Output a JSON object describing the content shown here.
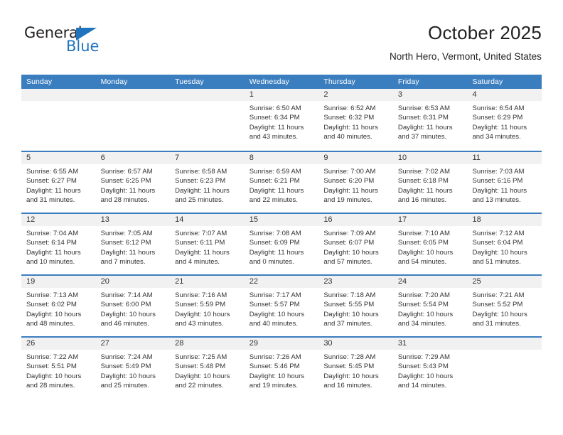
{
  "brand": {
    "name_primary": "General",
    "name_secondary": "Blue"
  },
  "header": {
    "title": "October 2025",
    "subtitle": "North Hero, Vermont, United States"
  },
  "colors": {
    "header_blue": "#3b7ebf",
    "brand_blue": "#1f74bd",
    "day_band_gray": "#f1f1f1",
    "text": "#333333"
  },
  "weekdays": [
    "Sunday",
    "Monday",
    "Tuesday",
    "Wednesday",
    "Thursday",
    "Friday",
    "Saturday"
  ],
  "labels": {
    "sunrise_prefix": "Sunrise: ",
    "sunset_prefix": "Sunset: ",
    "daylight_prefix": "Daylight: "
  },
  "weeks": [
    [
      {
        "empty": true
      },
      {
        "empty": true
      },
      {
        "empty": true
      },
      {
        "day": "1",
        "sunrise": "Sunrise: 6:50 AM",
        "sunset": "Sunset: 6:34 PM",
        "daylight": "Daylight: 11 hours and 43 minutes."
      },
      {
        "day": "2",
        "sunrise": "Sunrise: 6:52 AM",
        "sunset": "Sunset: 6:32 PM",
        "daylight": "Daylight: 11 hours and 40 minutes."
      },
      {
        "day": "3",
        "sunrise": "Sunrise: 6:53 AM",
        "sunset": "Sunset: 6:31 PM",
        "daylight": "Daylight: 11 hours and 37 minutes."
      },
      {
        "day": "4",
        "sunrise": "Sunrise: 6:54 AM",
        "sunset": "Sunset: 6:29 PM",
        "daylight": "Daylight: 11 hours and 34 minutes."
      }
    ],
    [
      {
        "day": "5",
        "sunrise": "Sunrise: 6:55 AM",
        "sunset": "Sunset: 6:27 PM",
        "daylight": "Daylight: 11 hours and 31 minutes."
      },
      {
        "day": "6",
        "sunrise": "Sunrise: 6:57 AM",
        "sunset": "Sunset: 6:25 PM",
        "daylight": "Daylight: 11 hours and 28 minutes."
      },
      {
        "day": "7",
        "sunrise": "Sunrise: 6:58 AM",
        "sunset": "Sunset: 6:23 PM",
        "daylight": "Daylight: 11 hours and 25 minutes."
      },
      {
        "day": "8",
        "sunrise": "Sunrise: 6:59 AM",
        "sunset": "Sunset: 6:21 PM",
        "daylight": "Daylight: 11 hours and 22 minutes."
      },
      {
        "day": "9",
        "sunrise": "Sunrise: 7:00 AM",
        "sunset": "Sunset: 6:20 PM",
        "daylight": "Daylight: 11 hours and 19 minutes."
      },
      {
        "day": "10",
        "sunrise": "Sunrise: 7:02 AM",
        "sunset": "Sunset: 6:18 PM",
        "daylight": "Daylight: 11 hours and 16 minutes."
      },
      {
        "day": "11",
        "sunrise": "Sunrise: 7:03 AM",
        "sunset": "Sunset: 6:16 PM",
        "daylight": "Daylight: 11 hours and 13 minutes."
      }
    ],
    [
      {
        "day": "12",
        "sunrise": "Sunrise: 7:04 AM",
        "sunset": "Sunset: 6:14 PM",
        "daylight": "Daylight: 11 hours and 10 minutes."
      },
      {
        "day": "13",
        "sunrise": "Sunrise: 7:05 AM",
        "sunset": "Sunset: 6:12 PM",
        "daylight": "Daylight: 11 hours and 7 minutes."
      },
      {
        "day": "14",
        "sunrise": "Sunrise: 7:07 AM",
        "sunset": "Sunset: 6:11 PM",
        "daylight": "Daylight: 11 hours and 4 minutes."
      },
      {
        "day": "15",
        "sunrise": "Sunrise: 7:08 AM",
        "sunset": "Sunset: 6:09 PM",
        "daylight": "Daylight: 11 hours and 0 minutes."
      },
      {
        "day": "16",
        "sunrise": "Sunrise: 7:09 AM",
        "sunset": "Sunset: 6:07 PM",
        "daylight": "Daylight: 10 hours and 57 minutes."
      },
      {
        "day": "17",
        "sunrise": "Sunrise: 7:10 AM",
        "sunset": "Sunset: 6:05 PM",
        "daylight": "Daylight: 10 hours and 54 minutes."
      },
      {
        "day": "18",
        "sunrise": "Sunrise: 7:12 AM",
        "sunset": "Sunset: 6:04 PM",
        "daylight": "Daylight: 10 hours and 51 minutes."
      }
    ],
    [
      {
        "day": "19",
        "sunrise": "Sunrise: 7:13 AM",
        "sunset": "Sunset: 6:02 PM",
        "daylight": "Daylight: 10 hours and 48 minutes."
      },
      {
        "day": "20",
        "sunrise": "Sunrise: 7:14 AM",
        "sunset": "Sunset: 6:00 PM",
        "daylight": "Daylight: 10 hours and 46 minutes."
      },
      {
        "day": "21",
        "sunrise": "Sunrise: 7:16 AM",
        "sunset": "Sunset: 5:59 PM",
        "daylight": "Daylight: 10 hours and 43 minutes."
      },
      {
        "day": "22",
        "sunrise": "Sunrise: 7:17 AM",
        "sunset": "Sunset: 5:57 PM",
        "daylight": "Daylight: 10 hours and 40 minutes."
      },
      {
        "day": "23",
        "sunrise": "Sunrise: 7:18 AM",
        "sunset": "Sunset: 5:55 PM",
        "daylight": "Daylight: 10 hours and 37 minutes."
      },
      {
        "day": "24",
        "sunrise": "Sunrise: 7:20 AM",
        "sunset": "Sunset: 5:54 PM",
        "daylight": "Daylight: 10 hours and 34 minutes."
      },
      {
        "day": "25",
        "sunrise": "Sunrise: 7:21 AM",
        "sunset": "Sunset: 5:52 PM",
        "daylight": "Daylight: 10 hours and 31 minutes."
      }
    ],
    [
      {
        "day": "26",
        "sunrise": "Sunrise: 7:22 AM",
        "sunset": "Sunset: 5:51 PM",
        "daylight": "Daylight: 10 hours and 28 minutes."
      },
      {
        "day": "27",
        "sunrise": "Sunrise: 7:24 AM",
        "sunset": "Sunset: 5:49 PM",
        "daylight": "Daylight: 10 hours and 25 minutes."
      },
      {
        "day": "28",
        "sunrise": "Sunrise: 7:25 AM",
        "sunset": "Sunset: 5:48 PM",
        "daylight": "Daylight: 10 hours and 22 minutes."
      },
      {
        "day": "29",
        "sunrise": "Sunrise: 7:26 AM",
        "sunset": "Sunset: 5:46 PM",
        "daylight": "Daylight: 10 hours and 19 minutes."
      },
      {
        "day": "30",
        "sunrise": "Sunrise: 7:28 AM",
        "sunset": "Sunset: 5:45 PM",
        "daylight": "Daylight: 10 hours and 16 minutes."
      },
      {
        "day": "31",
        "sunrise": "Sunrise: 7:29 AM",
        "sunset": "Sunset: 5:43 PM",
        "daylight": "Daylight: 10 hours and 14 minutes."
      },
      {
        "empty": true
      }
    ]
  ]
}
